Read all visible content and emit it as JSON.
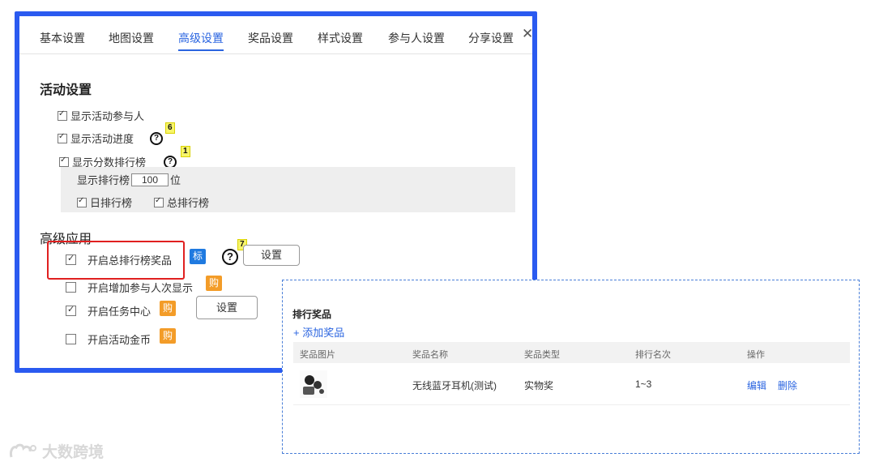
{
  "tabs": [
    "基本设置",
    "地图设置",
    "高级设置",
    "奖品设置",
    "样式设置",
    "参与人设置",
    "分享设置"
  ],
  "active_tab": "高级设置",
  "close_glyph": "✕",
  "activity_settings": {
    "title": "活动设置",
    "items": [
      {
        "label": "显示活动参与人",
        "checked": true
      },
      {
        "label": "显示活动进度",
        "checked": true,
        "help_badge": "6"
      },
      {
        "label": "显示分数排行榜",
        "checked": true,
        "help_badge": "1"
      }
    ],
    "ranking": {
      "prefix": "显示排行榜",
      "count": "100",
      "suffix": "位",
      "daily": "日排行榜",
      "total": "总排行榜"
    }
  },
  "advanced": {
    "title": "高级应用",
    "items": [
      {
        "label": "开启总排行榜奖品",
        "checked": true,
        "tag": "标",
        "help_badge": "7",
        "button": "设置"
      },
      {
        "label": "开启增加参与人次显示",
        "checked": false,
        "tag": "购"
      },
      {
        "label": "开启任务中心",
        "checked": true,
        "tag": "购",
        "button": "设置"
      },
      {
        "label": "开启活动金币",
        "checked": false,
        "tag": "购"
      }
    ]
  },
  "popup": {
    "title": "排行奖品",
    "add_label": "+ 添加奖品",
    "columns": [
      "奖品图片",
      "奖品名称",
      "奖品类型",
      "排行名次",
      "操作"
    ],
    "rows": [
      {
        "name": "无线蓝牙耳机(测试)",
        "type": "实物奖",
        "rank": "1~3",
        "edit": "编辑",
        "delete": "删除"
      }
    ]
  },
  "watermark": "大数跨境",
  "colors": {
    "accent_border": "#2a5af0",
    "link": "#2a64e0",
    "red_highlight": "#e02020",
    "tag_blue": "#1f7ae0",
    "tag_orange": "#f39c28"
  }
}
